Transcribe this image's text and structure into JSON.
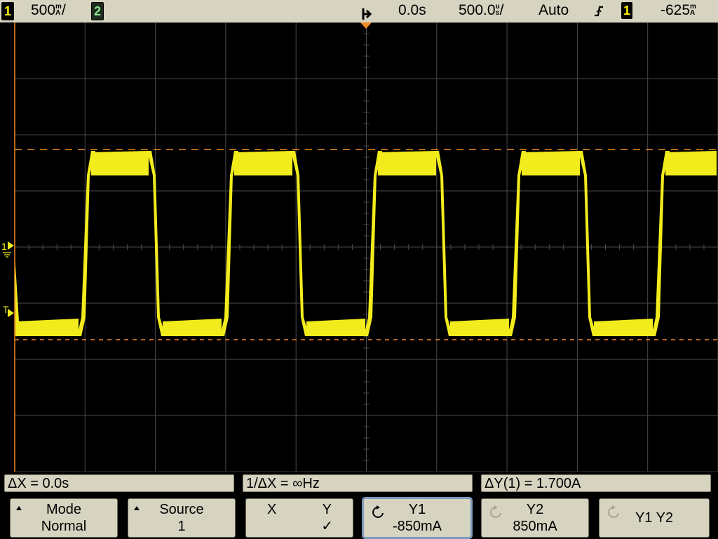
{
  "status_bar": {
    "ch1_label": "1",
    "ch1_scale": "500",
    "ch1_unit_top": "m",
    "ch1_unit_bottom": "A",
    "ch1_slash": "/",
    "ch2_label": "2",
    "time_offset": "0.0s",
    "time_scale": "500.0",
    "time_unit_top": "u",
    "time_unit_bottom": "s",
    "time_slash": "/",
    "trigger_mode": "Auto",
    "trigger_slope_icon": "rising-edge-icon",
    "trigger_source": "1",
    "trigger_level": "-625",
    "trigger_unit_top": "m",
    "trigger_unit_bottom": "A"
  },
  "graticule": {
    "ch1_marker": "1",
    "trigger_marker": "T",
    "trace_color": "#f2ec1c",
    "cursor_color": "#f08a24",
    "grid_color": "#4a4a4a"
  },
  "waveform": {
    "type": "square",
    "high_level": "high",
    "low_level": "low"
  },
  "measurements": {
    "delta_x": "ΔX = 0.0s",
    "inv_delta_x": "1/ΔX = ∞Hz",
    "delta_y": "ΔY(1) = 1.700A"
  },
  "softkeys": {
    "mode_label": "Mode",
    "mode_value": "Normal",
    "source_label": "Source",
    "source_value": "1",
    "x_label": "X",
    "y_label": "Y",
    "y_check": "✓",
    "y1_label": "Y1",
    "y1_value": "-850mA",
    "y2_label": "Y2",
    "y2_value": "850mA",
    "y1y2_label": "Y1 Y2"
  }
}
